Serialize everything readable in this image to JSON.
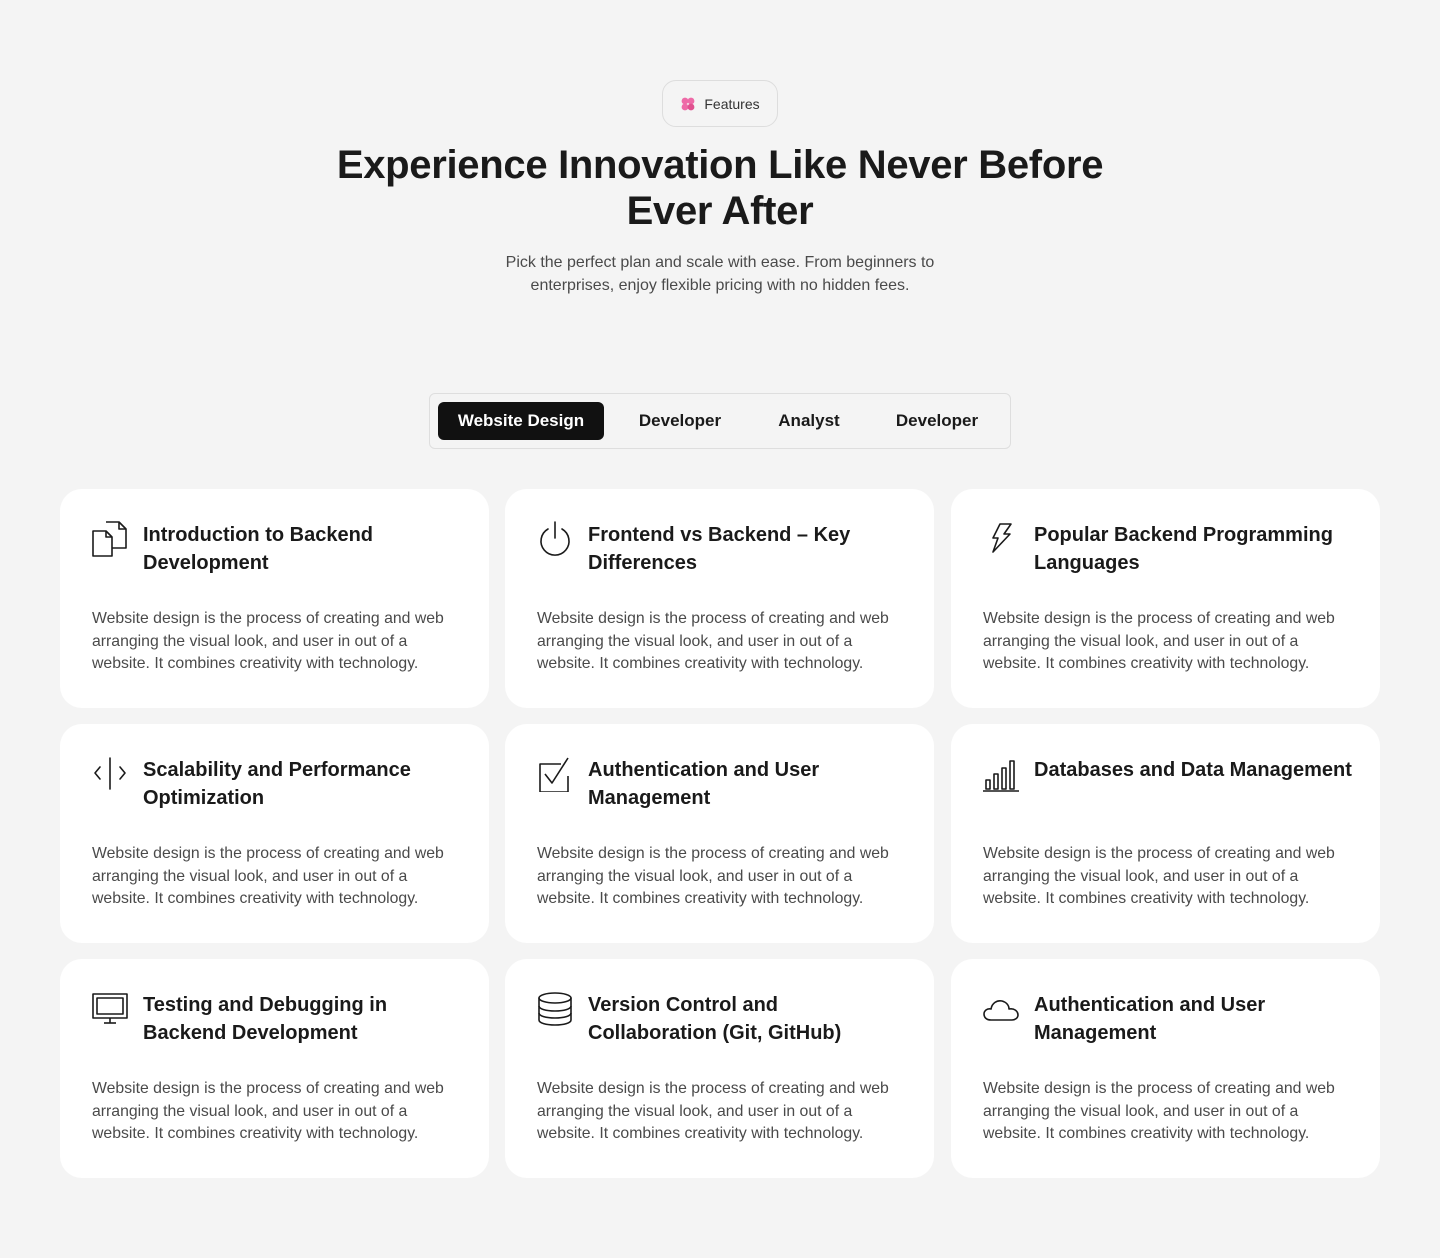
{
  "header": {
    "badge_label": "Features",
    "title": "Experience Innovation Like Never Before Ever After",
    "subtitle": "Pick the perfect plan and scale with ease. From beginners to enterprises, enjoy flexible pricing with no hidden fees."
  },
  "tabs": [
    {
      "label": "Website Design",
      "active": true
    },
    {
      "label": "Developer",
      "active": false
    },
    {
      "label": "Analyst",
      "active": false
    },
    {
      "label": "Developer",
      "active": false
    }
  ],
  "cards": [
    {
      "icon": "documents-icon",
      "title": "Introduction to Backend Development",
      "description": "Website design is the process of creating and web arranging the visual look, and user in out of a website. It combines creativity with technology."
    },
    {
      "icon": "power-icon",
      "title": "Frontend vs Backend – Key Differences",
      "description": "Website design is the process of creating and web arranging the visual look, and user in out of a website. It combines creativity with technology."
    },
    {
      "icon": "lightning-icon",
      "title": "Popular Backend Programming Languages",
      "description": "Website design is the process of creating and web arranging the visual look, and user in out of a website. It combines creativity with technology."
    },
    {
      "icon": "code-cursor-icon",
      "title": "Scalability and Performance Optimization",
      "description": "Website design is the process of creating and web arranging the visual look, and user in out of a website. It combines creativity with technology."
    },
    {
      "icon": "checkbox-icon",
      "title": "Authentication and User Management",
      "description": "Website design is the process of creating and web arranging the visual look, and user in out of a website. It combines creativity with technology."
    },
    {
      "icon": "bar-chart-icon",
      "title": "Databases and Data Management",
      "description": "Website design is the process of creating and web arranging the visual look, and user in out of a website. It combines creativity with technology."
    },
    {
      "icon": "monitor-icon",
      "title": "Testing and Debugging in Backend Development",
      "description": "Website design is the process of creating and web arranging the visual look, and user in out of a website. It combines creativity with technology."
    },
    {
      "icon": "database-icon",
      "title": "Version Control and Collaboration (Git, GitHub)",
      "description": "Website design is the process of creating and web arranging the visual look, and user in out of a website. It combines creativity with technology."
    },
    {
      "icon": "cloud-icon",
      "title": "Authentication and User Management",
      "description": "Website design is the process of creating and web arranging the visual look, and user in out of a website. It combines creativity with technology."
    }
  ],
  "colors": {
    "background": "#f4f4f4",
    "card": "#ffffff",
    "text": "#1a1a1a",
    "muted": "#4a4a4a",
    "accent_badge": "#e85fa0",
    "tab_active": "#111111"
  }
}
